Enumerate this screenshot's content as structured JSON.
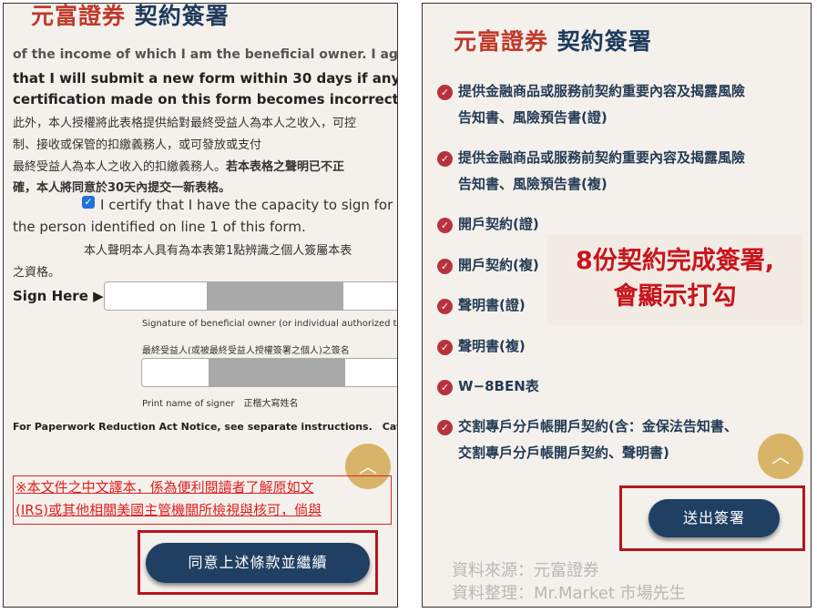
{
  "left_panel": {
    "title_brand": "元富證券",
    "title_rest": "契約簽署",
    "cut_line": "of the income of which I am the beneficial owner. I agree",
    "agree_line_1": "that I will submit a new form within 30 days if any",
    "agree_line_2": "certification made on this form becomes incorrect.",
    "zh_line_1": "此外，本人授權將此表格提供給對最終受益人為本人之收入，可控",
    "zh_line_2": "制、接收或保管的扣繳義務人，或可發放或支付",
    "zh_line_3_normal": "最終受益人為本人之收入的扣繳義務人。",
    "zh_line_3_bold": "若本表格之聲明已不正",
    "zh_line_4_bold": "確，本人將同意於30天內提交一新表格。",
    "certify_line_1": "I certify that I have the capacity to sign for",
    "certify_line_2": "the person identified on line 1 of this form.",
    "zh_capacity_1": "本人聲明本人具有為本表第1點辨識之個人簽屬本表",
    "zh_capacity_2": "之資格。",
    "sign_here": "Sign Here ▶",
    "signature_caption": "Signature of beneficial owner (or individual authorized to sign",
    "signature_caption_zh": "最終受益人(或被最終受益人授權簽署之個人)之簽名",
    "print_name_caption": "Print name of signer　正楷大寫姓名",
    "paperwork_notice": "For Paperwork Reduction Act Notice, see separate instructions.　Cat. No",
    "warning_line_1": "※本文件之中文譯本，係為便利閱讀者了解原如文",
    "warning_line_2": "(IRS)或其他相關美國主管機關所檢視與核可，倘與",
    "agree_button": "同意上述條款並繼續"
  },
  "right_panel": {
    "title_brand": "元富證券",
    "title_rest": "契約簽署",
    "items": [
      {
        "line1": "提供金融商品或服務前契約重要內容及揭露風險",
        "line2": "告知書、風險預告書(證)"
      },
      {
        "line1": "提供金融商品或服務前契約重要內容及揭露風險",
        "line2": "告知書、風險預告書(複)"
      },
      {
        "line1": "開戶契約(證)",
        "line2": ""
      },
      {
        "line1": "開戶契約(複)",
        "line2": ""
      },
      {
        "line1": "聲明書(證)",
        "line2": ""
      },
      {
        "line1": "聲明書(複)",
        "line2": ""
      },
      {
        "line1": "W−8BEN表",
        "line2": ""
      },
      {
        "line1": "交割專戶分戶帳開戶契約(含：金保法告知書、",
        "line2": "交割專戶分戶帳開戶契約、聲明書)"
      }
    ],
    "callout_line_1": "8份契約完成簽署,",
    "callout_line_2": "會顯示打勾",
    "submit_button": "送出簽署"
  },
  "source_line": "資料來源：元富證券",
  "compiler_line": "資料整理：Mr.Market 市場先生",
  "icons": {
    "check": "check-circle-icon",
    "scroll_top": "chevron-up-icon"
  },
  "colors": {
    "brand_red": "#c0392b",
    "navy": "#1f3f63",
    "accent_gold": "#d8b468",
    "highlight_red": "#b8141c"
  }
}
